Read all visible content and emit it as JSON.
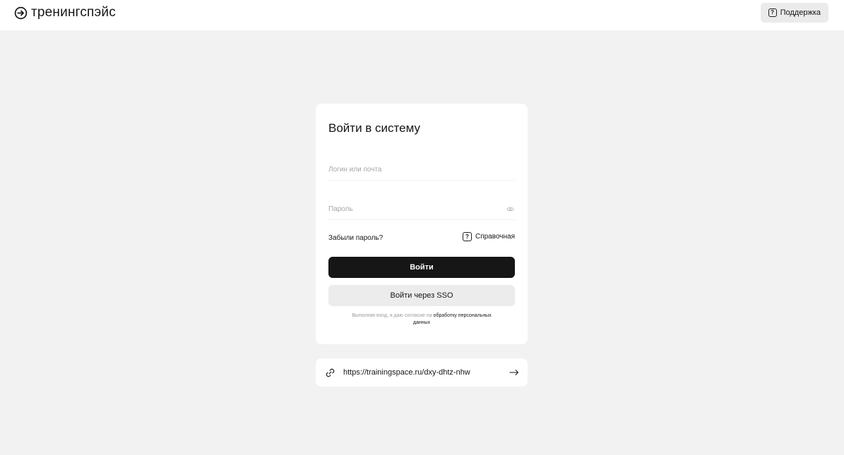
{
  "header": {
    "logo_text": "тренингспэйс",
    "support_label": "Поддержка"
  },
  "login": {
    "title": "Войти в систему",
    "login_placeholder": "Логин или почта",
    "login_value": "",
    "password_placeholder": "Пароль",
    "password_value": "",
    "forgot_label": "Забыли пароль?",
    "help_label": "Справочная",
    "submit_label": "Войти",
    "sso_label": "Войти через SSO",
    "consent_text": "Выполняя вход, я даю согласие на ",
    "consent_link": "обработку персональных данных"
  },
  "room_link": {
    "url": "https://trainingspace.ru/dxy-dhtz-nhw"
  },
  "colors": {
    "background": "#f2f2f2",
    "surface": "#ffffff",
    "primary_button": "#161616",
    "secondary_button": "#ececec"
  },
  "icons": {
    "logo": "login-arrow-icon",
    "support": "question-box-icon",
    "password_toggle": "eye-icon",
    "help": "question-box-icon",
    "room_link": "chain-link-icon",
    "go": "arrow-right-icon"
  }
}
